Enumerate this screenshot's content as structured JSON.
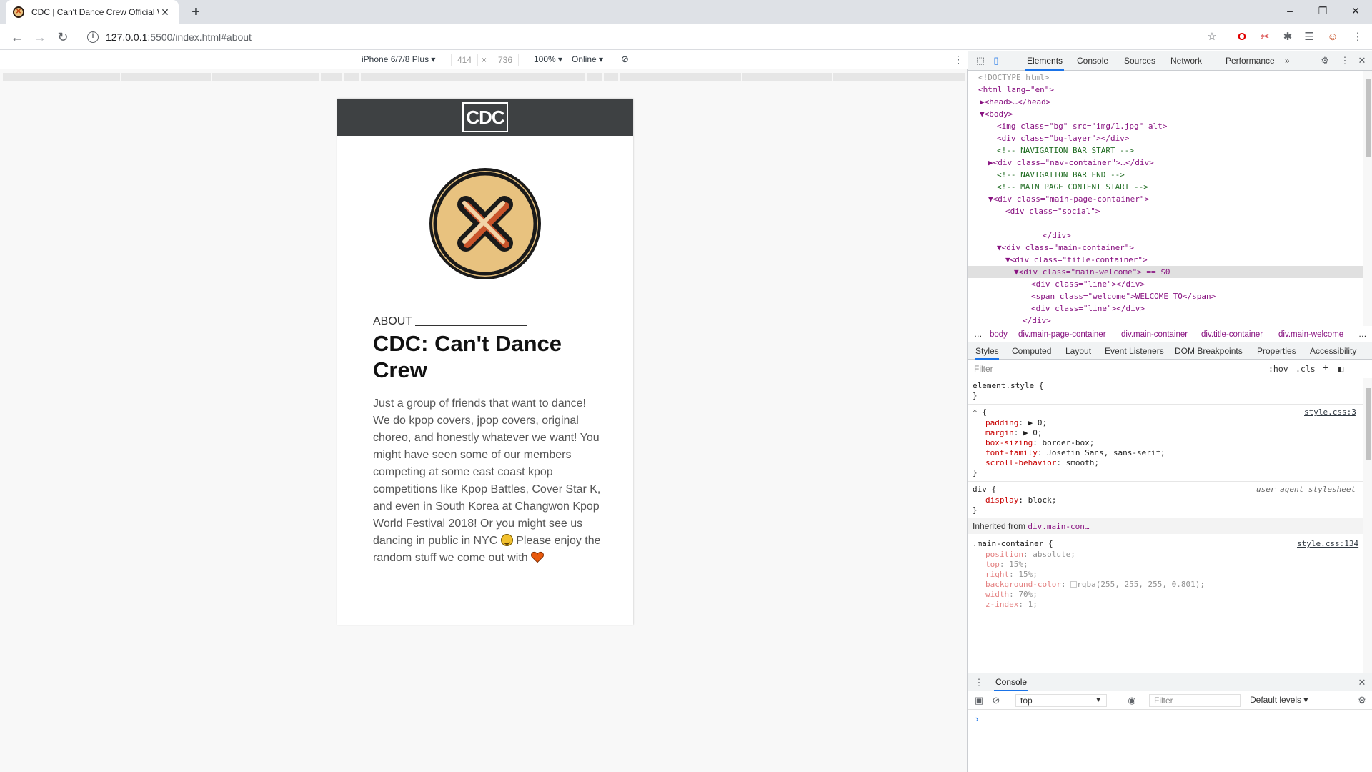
{
  "browser": {
    "tab_title": "CDC | Can't Dance Crew Official W",
    "tab_favicon": "cdc-x-favicon",
    "new_tab_label": "+",
    "url_host": "127.0.0.1",
    "url_path": ":5500/index.html#about",
    "window_controls": {
      "minimize": "–",
      "restore": "❐",
      "close": "✕"
    }
  },
  "device_toolbar": {
    "device": "iPhone 6/7/8 Plus",
    "width": "414",
    "times": "×",
    "height": "736",
    "zoom": "100%",
    "network": "Online"
  },
  "page": {
    "logo": "CDC",
    "about_label": "ABOUT",
    "about_title": "CDC: Can't Dance Crew",
    "about_body_1": "Just a group of friends that want to dance! We do kpop covers, jpop covers, original choreo, and honestly whatever we want! You might have seen some of our members competing at some east coast kpop competitions like Kpop Battles, Cover Star K, and even in South Korea at Changwon Kpop World Festival 2018! Or you might see us dancing in public in NYC",
    "about_body_2": "Please enjoy the random stuff we come out with",
    "colors": {
      "header": "#3e4143",
      "logo_ring": "#e8c27f",
      "x_mark": "#c8532a"
    }
  },
  "devtools": {
    "tabs": [
      "Elements",
      "Console",
      "Sources",
      "Network",
      "Performance",
      "»"
    ],
    "dom": [
      {
        "t": "<!DOCTYPE html>"
      },
      {
        "t": "<html lang=\"en\">"
      },
      {
        "t": "▶<head>…</head>"
      },
      {
        "t": "▼<body>"
      },
      {
        "t": "<img class=\"bg\" src=\"img/1.jpg\" alt>"
      },
      {
        "t": "<div class=\"bg-layer\"></div>"
      },
      {
        "t": "<!-- NAVIGATION BAR START -->"
      },
      {
        "t": "▶<div class=\"nav-container\">…</div>"
      },
      {
        "t": "<!-- NAVIGATION BAR END -->"
      },
      {
        "t": "<!-- MAIN PAGE CONTENT START -->"
      },
      {
        "t": "▼<div class=\"main-page-container\">"
      },
      {
        "t": "<div class=\"social\">"
      },
      {
        "t": "</div>"
      },
      {
        "t": "▼<div class=\"main-container\">"
      },
      {
        "t": "▼<div class=\"title-container\">"
      },
      {
        "t": "▼<div class=\"main-welcome\"> == $0"
      },
      {
        "t": "<div class=\"line\"></div>"
      },
      {
        "t": "<span class=\"welcome\">WELCOME TO</span>"
      },
      {
        "t": "<div class=\"line\"></div>"
      },
      {
        "t": "</div>"
      }
    ],
    "breadcrumbs": [
      "…",
      "body",
      "div.main-page-container",
      "div.main-container",
      "div.title-container",
      "div.main-welcome",
      "…"
    ],
    "style_tabs": [
      "Styles",
      "Computed",
      "Layout",
      "Event Listeners",
      "DOM Breakpoints",
      "Properties",
      "Accessibility"
    ],
    "filter_placeholder": "Filter",
    "hov": ":hov",
    "cls": ".cls",
    "styles": {
      "element_style": "element.style {",
      "universal_selector": "* {",
      "universal_source": "style.css:3",
      "universal_props": [
        [
          "padding",
          "▶ 0;"
        ],
        [
          "margin",
          "▶ 0;"
        ],
        [
          "box-sizing",
          "border-box;"
        ],
        [
          "font-family",
          "Josefin Sans, sans-serif;"
        ],
        [
          "scroll-behavior",
          "smooth;"
        ]
      ],
      "div_selector": "div {",
      "div_source": "user agent stylesheet",
      "div_props": [
        [
          "display",
          "block;"
        ]
      ],
      "inherited_label": "Inherited from",
      "inherited_from": "div.main-con…",
      "main_selector": ".main-container {",
      "main_source": "style.css:134",
      "main_props": [
        [
          "position",
          "absolute;"
        ],
        [
          "top",
          "15%;"
        ],
        [
          "right",
          "15%;"
        ],
        [
          "background-color",
          "rgba(255, 255, 255, 0.801);"
        ],
        [
          "width",
          "70%;"
        ],
        [
          "z-index",
          "1;"
        ]
      ]
    },
    "drawer": {
      "title": "Console",
      "context": "top",
      "filter_placeholder": "Filter",
      "levels": "Default levels ▾",
      "prompt": "›"
    }
  }
}
